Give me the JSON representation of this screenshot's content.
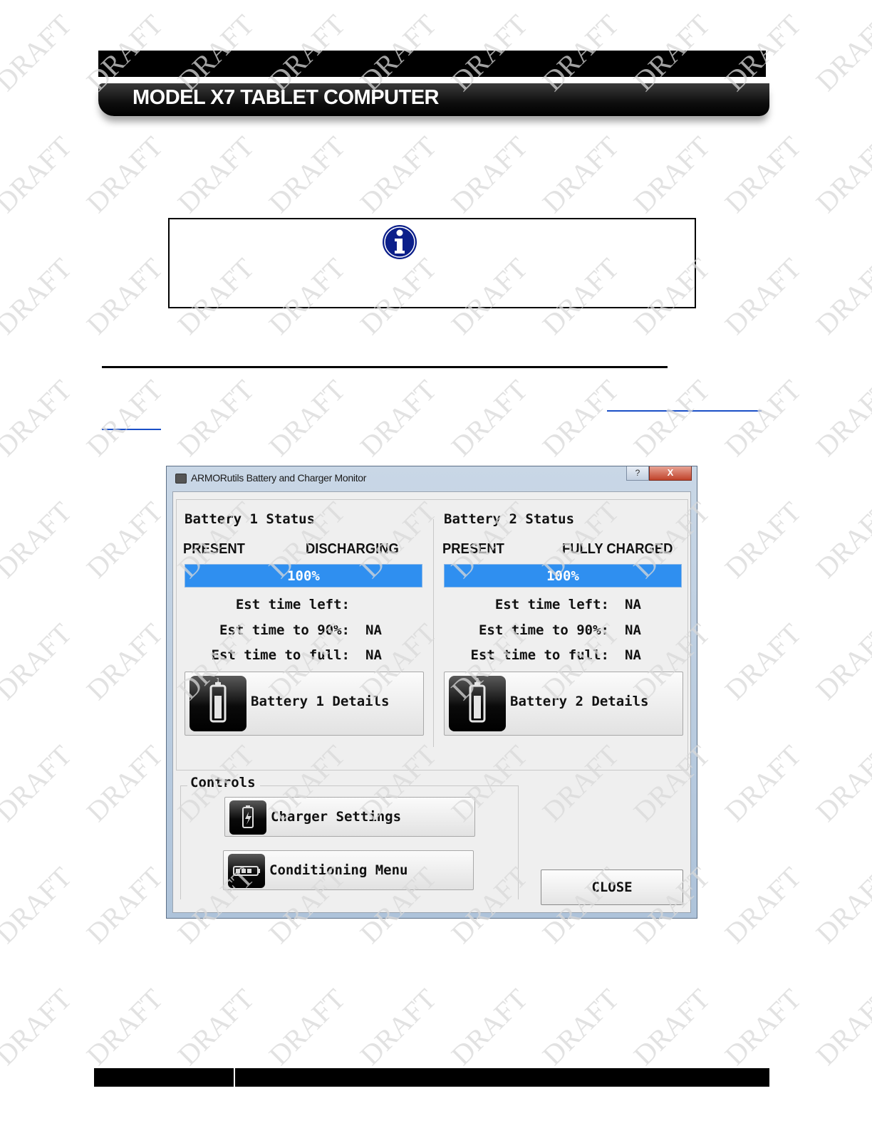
{
  "header": {
    "title": "MODEL X7 TABLETCOMPUTER"
  },
  "header_title": "MODEL X7 TABLET COMPUTER",
  "watermark": {
    "text": "DRAFT"
  },
  "icons": {
    "info": "info-circle-icon",
    "battery": "battery-icon",
    "charger": "charger-icon",
    "conditioning": "battery-horizontal-icon"
  },
  "window": {
    "title": "ARMORutils Battery and Charger Monitor",
    "help_label": "?",
    "close_label": "X",
    "battery1": {
      "heading": "Battery 1 Status",
      "state": "PRESENT",
      "charge_state": "DISCHARGING",
      "progress_text": "100%",
      "progress": 1.0,
      "est_time_left_label": "Est time left:",
      "est_time_left_value": "",
      "est_time_90_label": "Est time to 90%:",
      "est_time_90_value": "NA",
      "est_time_full_label": "Est time to full:",
      "est_time_full_value": "NA",
      "details_button": "Battery 1 Details",
      "icon_number": "1"
    },
    "battery2": {
      "heading": "Battery 2 Status",
      "state": "PRESENT",
      "charge_state": "FULLY CHARGED",
      "progress_text": "100%",
      "progress": 1.0,
      "est_time_left_label": "Est time left:",
      "est_time_left_value": "NA",
      "est_time_90_label": "Est time to 90%:",
      "est_time_90_value": "NA",
      "est_time_full_label": "Est time to full:",
      "est_time_full_value": "NA",
      "details_button": "Battery 2 Details",
      "icon_number": "2"
    },
    "controls": {
      "heading": "Controls",
      "charger_settings": "Charger Settings",
      "conditioning_menu": "Conditioning Menu"
    },
    "close_button": "CLOSE"
  },
  "colors": {
    "progress_fill": "#2f8ff0",
    "info_icon": "#0b1f8a",
    "link_underline": "#1a4fc7"
  }
}
